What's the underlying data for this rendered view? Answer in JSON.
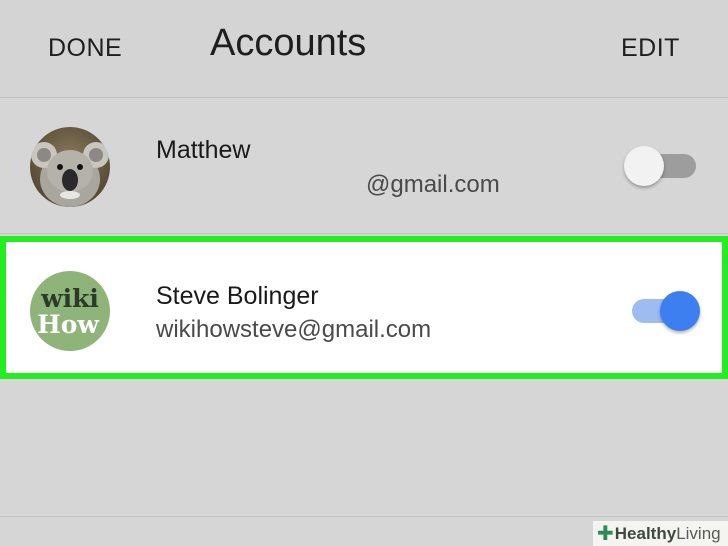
{
  "header": {
    "done_label": "DONE",
    "title": "Accounts",
    "edit_label": "EDIT"
  },
  "accounts": [
    {
      "name": "Matthew",
      "email": "@gmail.com",
      "avatar": "koala-photo",
      "enabled": false,
      "selected": false
    },
    {
      "name": "Steve Bolinger",
      "email": "wikihowsteve@gmail.com",
      "avatar": "wikihow-logo",
      "avatar_text": [
        "wiki",
        "How"
      ],
      "enabled": true,
      "selected": true
    }
  ],
  "watermark": {
    "word1": "Healthy",
    "word2": "Living"
  },
  "colors": {
    "highlight": "#22ee22",
    "toggle_on": "#3d7ff0",
    "background": "#d6d6d6"
  }
}
